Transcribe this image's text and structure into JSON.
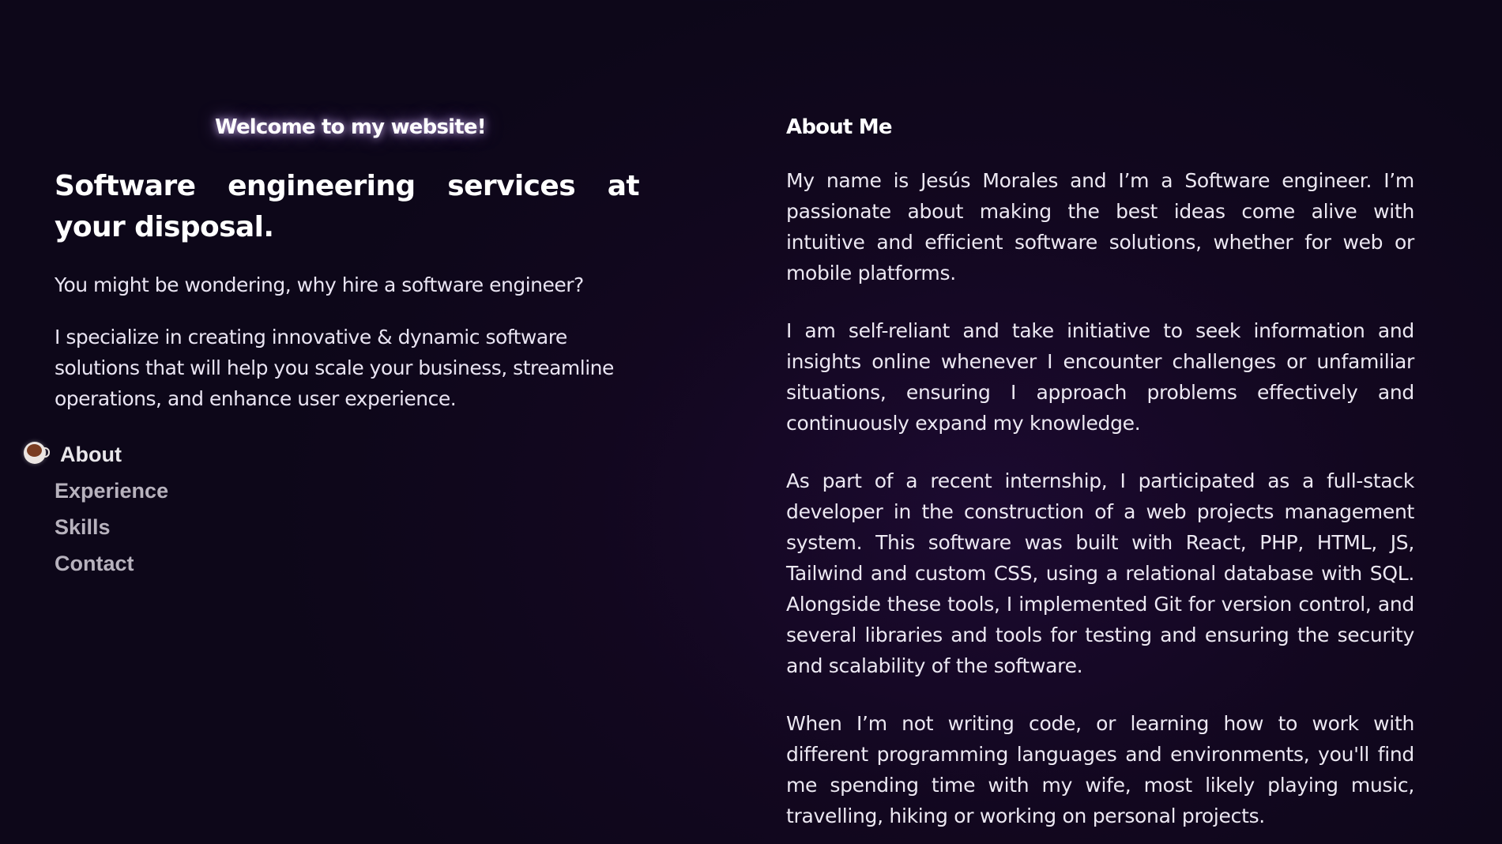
{
  "left": {
    "welcome": "Welcome to my website!",
    "headline": "Software engineering services at your disposal.",
    "question": "You might be wondering, why hire a software engineer?",
    "intro": "I specialize in creating innovative & dynamic software solutions that will help you scale your business, streamline operations, and enhance user experience."
  },
  "nav": {
    "active_icon": "coffee-cup-icon",
    "items": [
      {
        "label": "About",
        "active": true
      },
      {
        "label": "Experience",
        "active": false
      },
      {
        "label": "Skills",
        "active": false
      },
      {
        "label": "Contact",
        "active": false
      }
    ]
  },
  "about": {
    "title": "About Me",
    "paragraphs": [
      "My name is Jesús Morales and I’m a Software engineer. I’m passionate about making the best ideas come alive with intuitive and efficient software solutions, whether for web or mobile platforms.",
      "I am self-reliant and take initiative to seek information and insights online whenever I encounter challenges or unfamiliar situations, ensuring I approach problems effectively and continuously expand my knowledge.",
      "As part of a recent internship, I participated as a full-stack developer in the construction of a web projects management system. This software was built with React, PHP, HTML, JS, Tailwind and custom CSS, using a relational database with SQL. Alongside these tools, I implemented Git for version control, and several libraries and tools for testing and ensuring the security and scalability of the software.",
      "When I’m not writing code, or learning how to work with different programming languages and environments, you'll find me spending time with my wife, most likely playing music, travelling, hiking or working on personal projects."
    ]
  },
  "colors": {
    "background": "#12071f",
    "text": "#ece8f2",
    "nav_inactive": "#b7b2bd",
    "glow": "#dcbeff"
  }
}
